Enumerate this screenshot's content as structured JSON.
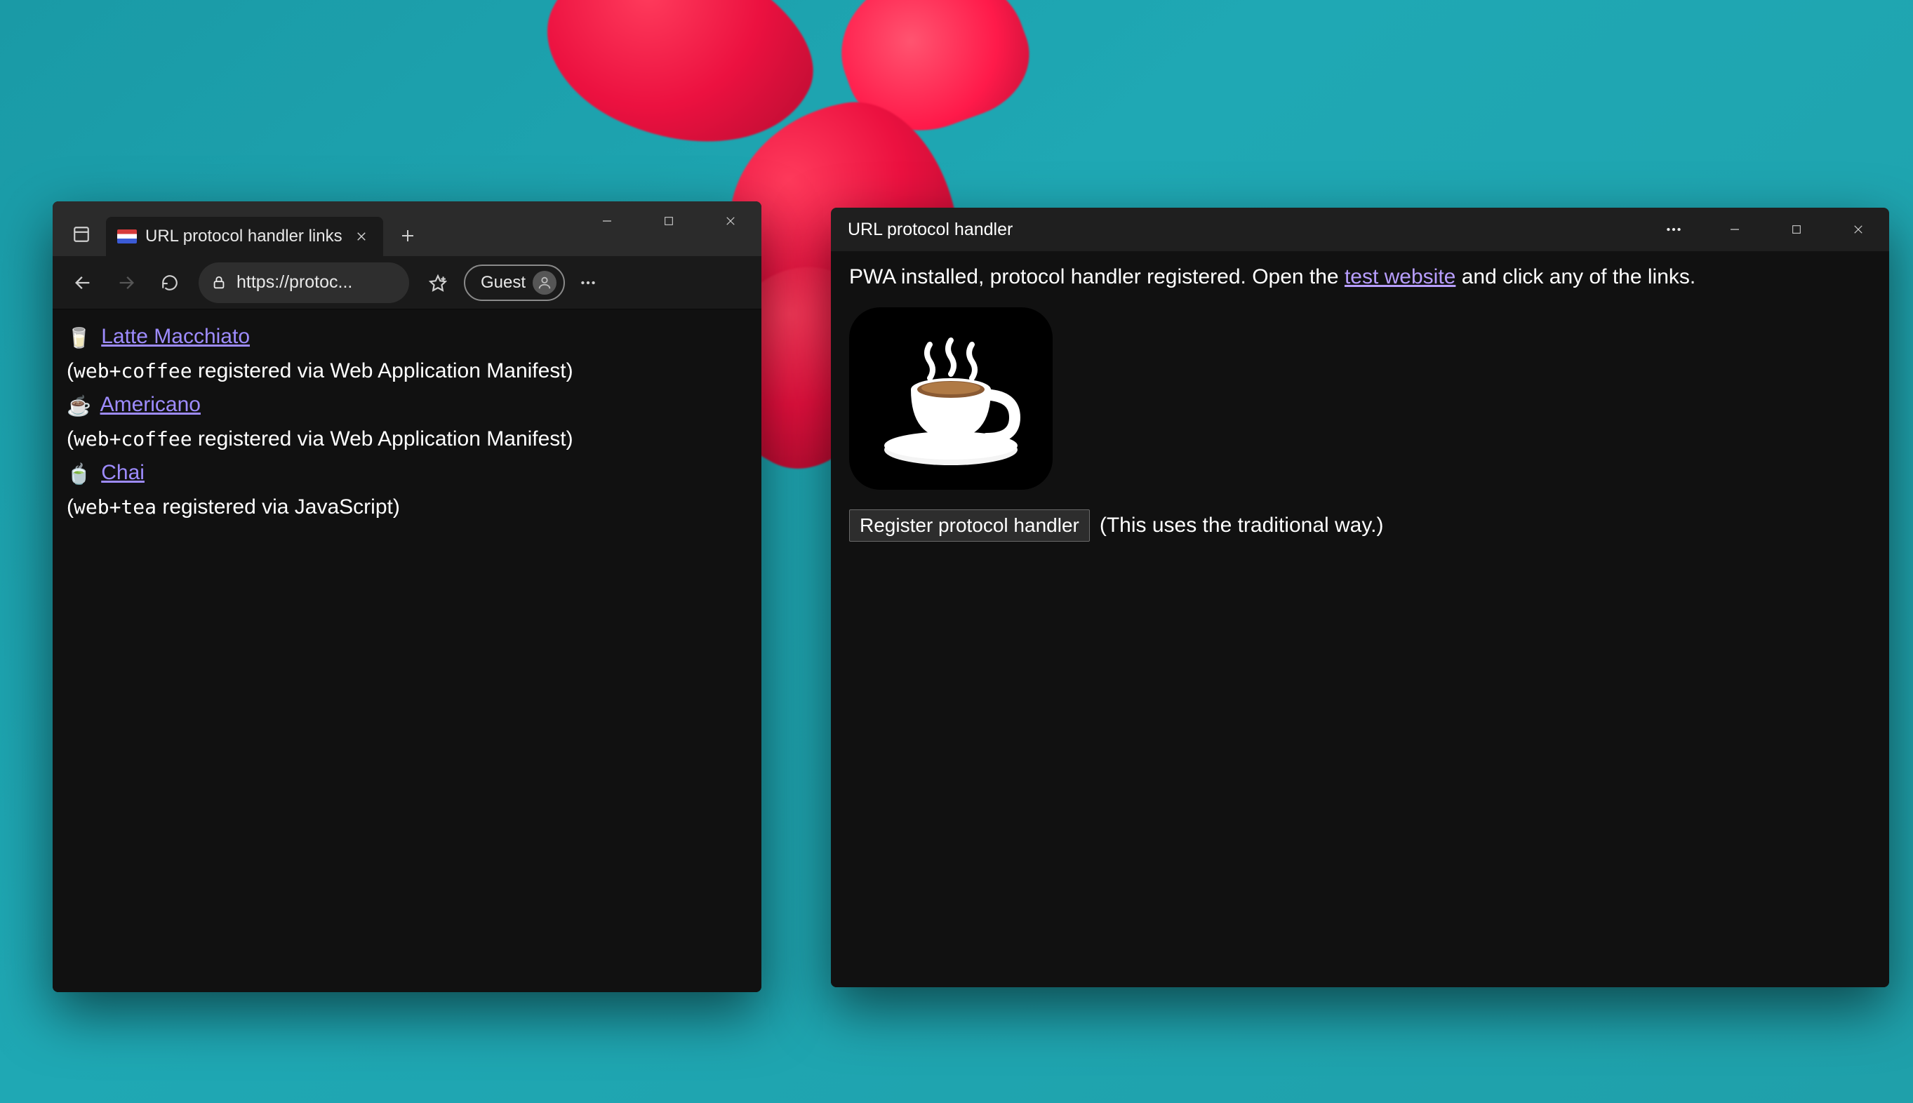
{
  "browser": {
    "tab": {
      "title": "URL protocol handler links"
    },
    "address": "https://protoc...",
    "guest_label": "Guest",
    "page": {
      "links": [
        {
          "emoji": "🥛",
          "label": "Latte Macchiato",
          "proto": "web+coffee",
          "via": "registered via Web Application Manifest)"
        },
        {
          "emoji": "☕️",
          "label": "Americano",
          "proto": "web+coffee",
          "via": "registered via Web Application Manifest)"
        },
        {
          "emoji": "🍵",
          "label": "Chai",
          "proto": "web+tea",
          "via": "registered via JavaScript)"
        }
      ]
    }
  },
  "pwa": {
    "title": "URL protocol handler",
    "msg_prefix": "PWA installed, protocol handler registered. Open the ",
    "msg_link": "test website",
    "msg_suffix": " and click any of the links.",
    "button": "Register protocol handler",
    "note": "(This uses the traditional way.)"
  }
}
